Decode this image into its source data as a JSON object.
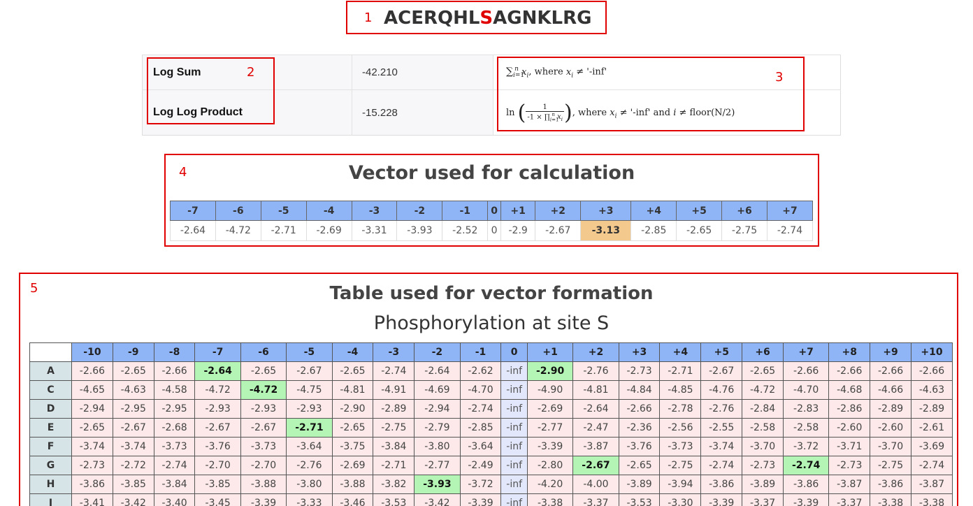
{
  "annotations": [
    "1",
    "2",
    "3",
    "4",
    "5"
  ],
  "sequence": {
    "before": "ACERQHL",
    "site": "S",
    "after": "AGNKLRG"
  },
  "metrics": [
    {
      "label": "Log Sum",
      "value": "-42.210"
    },
    {
      "label": "Log Log Product",
      "value": "-15.228"
    }
  ],
  "formulas": {
    "log_sum_tail": ", where ",
    "log_sum_cond": "≠ '-inf'",
    "log_log_prefix": "ln",
    "log_log_num": "1",
    "log_log_tail": ", where ",
    "log_log_cond": "≠ '-inf' and ",
    "log_log_cond2": "≠ floor(N/2)"
  },
  "vector": {
    "title": "Vector used for calculation",
    "headers": [
      "-7",
      "-6",
      "-5",
      "-4",
      "-3",
      "-2",
      "-1",
      "0",
      "+1",
      "+2",
      "+3",
      "+4",
      "+5",
      "+6",
      "+7"
    ],
    "values": [
      "-2.64",
      "-4.72",
      "-2.71",
      "-2.69",
      "-3.31",
      "-3.93",
      "-2.52",
      "0",
      "-2.9",
      "-2.67",
      "-3.13",
      "-2.85",
      "-2.65",
      "-2.75",
      "-2.74"
    ],
    "highlight_index": 10,
    "highlight_color": "#f3c98e"
  },
  "table": {
    "title": "Table used for vector formation",
    "subtitle": "Phosphorylation at site S",
    "columns": [
      "-10",
      "-9",
      "-8",
      "-7",
      "-6",
      "-5",
      "-4",
      "-3",
      "-2",
      "-1",
      "0",
      "+1",
      "+2",
      "+3",
      "+4",
      "+5",
      "+6",
      "+7",
      "+8",
      "+9",
      "+10"
    ],
    "selected_color": "#b4f4b4",
    "rows": [
      {
        "aa": "A",
        "values": [
          "-2.66",
          "-2.65",
          "-2.66",
          "-2.64",
          "-2.65",
          "-2.67",
          "-2.65",
          "-2.74",
          "-2.64",
          "-2.62",
          "-inf",
          "-2.90",
          "-2.76",
          "-2.73",
          "-2.71",
          "-2.67",
          "-2.65",
          "-2.66",
          "-2.66",
          "-2.66",
          "-2.66"
        ],
        "selected": [
          3,
          11
        ]
      },
      {
        "aa": "C",
        "values": [
          "-4.65",
          "-4.63",
          "-4.58",
          "-4.72",
          "-4.72",
          "-4.75",
          "-4.81",
          "-4.91",
          "-4.69",
          "-4.70",
          "-inf",
          "-4.90",
          "-4.81",
          "-4.84",
          "-4.85",
          "-4.76",
          "-4.72",
          "-4.70",
          "-4.68",
          "-4.66",
          "-4.63"
        ],
        "selected": [
          4
        ]
      },
      {
        "aa": "D",
        "values": [
          "-2.94",
          "-2.95",
          "-2.95",
          "-2.93",
          "-2.93",
          "-2.93",
          "-2.90",
          "-2.89",
          "-2.94",
          "-2.74",
          "-inf",
          "-2.69",
          "-2.64",
          "-2.66",
          "-2.78",
          "-2.76",
          "-2.84",
          "-2.83",
          "-2.86",
          "-2.89",
          "-2.89"
        ],
        "selected": []
      },
      {
        "aa": "E",
        "values": [
          "-2.65",
          "-2.67",
          "-2.68",
          "-2.67",
          "-2.67",
          "-2.71",
          "-2.65",
          "-2.75",
          "-2.79",
          "-2.85",
          "-inf",
          "-2.77",
          "-2.47",
          "-2.36",
          "-2.56",
          "-2.55",
          "-2.58",
          "-2.58",
          "-2.60",
          "-2.60",
          "-2.61"
        ],
        "selected": [
          5
        ]
      },
      {
        "aa": "F",
        "values": [
          "-3.74",
          "-3.74",
          "-3.73",
          "-3.76",
          "-3.73",
          "-3.64",
          "-3.75",
          "-3.84",
          "-3.80",
          "-3.64",
          "-inf",
          "-3.39",
          "-3.87",
          "-3.76",
          "-3.73",
          "-3.74",
          "-3.70",
          "-3.72",
          "-3.71",
          "-3.70",
          "-3.69"
        ],
        "selected": []
      },
      {
        "aa": "G",
        "values": [
          "-2.73",
          "-2.72",
          "-2.74",
          "-2.70",
          "-2.70",
          "-2.76",
          "-2.69",
          "-2.71",
          "-2.77",
          "-2.49",
          "-inf",
          "-2.80",
          "-2.67",
          "-2.65",
          "-2.75",
          "-2.74",
          "-2.73",
          "-2.74",
          "-2.73",
          "-2.75",
          "-2.74"
        ],
        "selected": [
          12,
          17
        ]
      },
      {
        "aa": "H",
        "values": [
          "-3.86",
          "-3.85",
          "-3.84",
          "-3.85",
          "-3.88",
          "-3.80",
          "-3.88",
          "-3.82",
          "-3.93",
          "-3.72",
          "-inf",
          "-4.20",
          "-4.00",
          "-3.89",
          "-3.94",
          "-3.86",
          "-3.89",
          "-3.86",
          "-3.87",
          "-3.86",
          "-3.87"
        ],
        "selected": [
          8
        ]
      },
      {
        "aa": "I",
        "values": [
          "-3.41",
          "-3.42",
          "-3.40",
          "-3.45",
          "-3.39",
          "-3.33",
          "-3.46",
          "-3.53",
          "-3.42",
          "-3.39",
          "-inf",
          "-3.38",
          "-3.37",
          "-3.53",
          "-3.30",
          "-3.39",
          "-3.37",
          "-3.39",
          "-3.37",
          "-3.38",
          "-3.38"
        ],
        "selected": []
      }
    ]
  }
}
